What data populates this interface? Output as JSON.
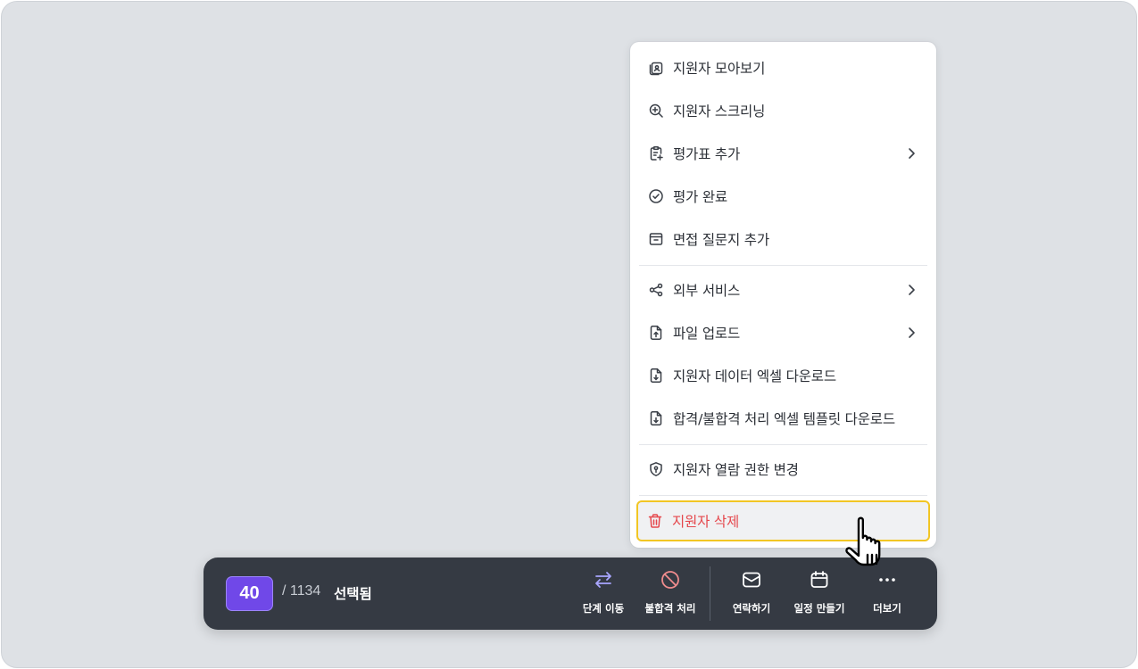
{
  "menu": {
    "items": [
      {
        "label": "지원자 모아보기",
        "icon": "applicant-collection-icon"
      },
      {
        "label": "지원자 스크리닝",
        "icon": "search-plus-icon"
      },
      {
        "label": "평가표 추가",
        "icon": "clipboard-plus-icon",
        "submenu": true
      },
      {
        "label": "평가 완료",
        "icon": "check-circle-icon"
      },
      {
        "label": "면접 질문지 추가",
        "icon": "archive-icon"
      },
      {
        "label": "외부 서비스",
        "icon": "share-nodes-icon",
        "submenu": true
      },
      {
        "label": "파일 업로드",
        "icon": "file-upload-icon",
        "submenu": true
      },
      {
        "label": "지원자 데이터 엑셀 다운로드",
        "icon": "file-download-icon"
      },
      {
        "label": "합격/불합격 처리 엑셀 템플릿 다운로드",
        "icon": "file-download-icon"
      },
      {
        "label": "지원자 열람 권한 변경",
        "icon": "shield-lock-icon"
      },
      {
        "label": "지원자 삭제",
        "icon": "trash-icon",
        "danger": true
      }
    ]
  },
  "action_bar": {
    "selected_count": "40",
    "total": "/ 1134",
    "selected_label": "선택됨",
    "actions": [
      {
        "label": "단계 이동",
        "icon": "swap-arrows-icon"
      },
      {
        "label": "불합격 처리",
        "icon": "prohibited-icon"
      },
      {
        "label": "연락하기",
        "icon": "mail-icon"
      },
      {
        "label": "일정 만들기",
        "icon": "calendar-icon"
      },
      {
        "label": "더보기",
        "icon": "more-dots-icon"
      }
    ]
  },
  "colors": {
    "background": "#dee1e5",
    "bar": "#353a43",
    "badge": "#7048e8",
    "danger": "#e5484d",
    "highlight_border": "#f2c624",
    "action_icon_accent": "#a9a6ff",
    "reject_icon": "#f08c8e"
  }
}
